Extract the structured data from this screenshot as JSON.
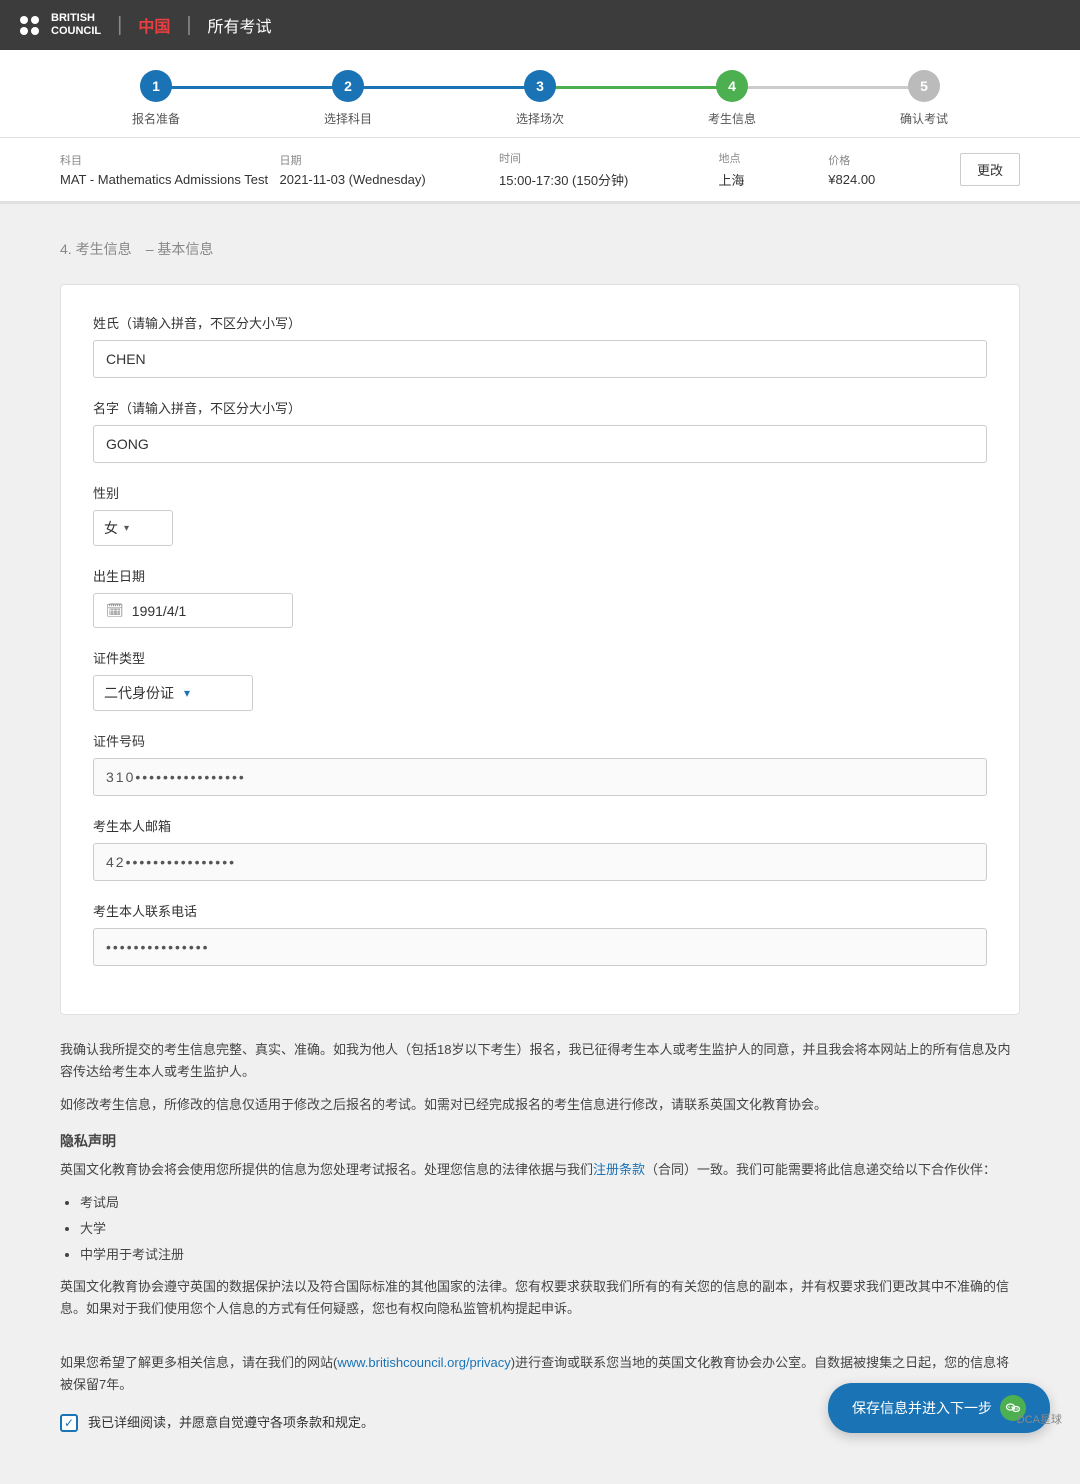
{
  "header": {
    "logo_line1": "BRITISH",
    "logo_line2": "COUNCIL",
    "divider": "|",
    "china": "中国",
    "separator": "|",
    "title": "所有考试"
  },
  "progress": {
    "steps": [
      {
        "id": 1,
        "label": "报名准备",
        "state": "completed"
      },
      {
        "id": 2,
        "label": "选择科目",
        "state": "completed"
      },
      {
        "id": 3,
        "label": "选择场次",
        "state": "completed"
      },
      {
        "id": 4,
        "label": "考生信息",
        "state": "active"
      },
      {
        "id": 5,
        "label": "确认考试",
        "state": "inactive"
      }
    ]
  },
  "exam_bar": {
    "subject_label": "科目",
    "subject_value": "MAT - Mathematics Admissions Test",
    "date_label": "日期",
    "date_value": "2021-11-03 (Wednesday)",
    "time_label": "时间",
    "time_value": "15:00-17:30 (150分钟)",
    "location_label": "地点",
    "location_value": "上海",
    "price_label": "价格",
    "price_value": "¥824.00",
    "change_btn": "更改"
  },
  "section": {
    "title": "4. 考生信息",
    "subtitle": "– 基本信息"
  },
  "form": {
    "lastname_label": "姓氏（请输入拼音，不区分大小写）",
    "lastname_value": "CHEN",
    "firstname_label": "名字（请输入拼音，不区分大小写）",
    "firstname_value": "GONG",
    "gender_label": "性别",
    "gender_value": "女",
    "gender_chevron": "▾",
    "dob_label": "出生日期",
    "dob_value": "1991/4/1",
    "calendar_icon": "📅",
    "cert_type_label": "证件类型",
    "cert_type_value": "二代身份证",
    "cert_chevron": "▾",
    "cert_num_label": "证件号码",
    "cert_num_value": "310••••••••••••••••",
    "email_label": "考生本人邮箱",
    "email_value": "42••••••••••••••••",
    "phone_label": "考生本人联系电话",
    "phone_value": "•••••••••••••••"
  },
  "notice": {
    "text1": "我确认我所提交的考生信息完整、真实、准确。如我为他人（包括18岁以下考生）报名，我已征得考生本人或考生监护人的同意，并且我会将本网站上的所有信息及内容传达给考生本人或考生监护人。",
    "text2": "如修改考生信息，所修改的信息仅适用于修改之后报名的考试。如需对已经完成报名的考生信息进行修改，请联系英国文化教育协会。"
  },
  "privacy": {
    "title": "隐私声明",
    "text1": "英国文化教育协会将会使用您所提供的信息为您处理考试报名。处理您信息的法律依据与我们",
    "link_text": "注册条款",
    "text1_cont": "（合同）一致。我们可能需要将此信息递交给以下合作伙伴：",
    "list_items": [
      "考试局",
      "大学",
      "中学用于考试注册"
    ],
    "text2": "英国文化教育协会遵守英国的数据保护法以及符合国际标准的其他国家的法律。您有权要求获取我们所有的有关您的信息的副本，并有权要求我们更改其中不准确的信息。如果对于我们使用您个人信息的方式有任何疑惑，您也有权向隐私监管机构提起申诉。",
    "text3": "如果您希望了解更多相关信息，请在我们的网站(",
    "link2_text": "www.britishcouncil.org/privacy",
    "text3_cont": ")进行查询或联系您当地的英国文化教育协会办公室。自数据被搜集之日起，您的信息将被保留7年。"
  },
  "checkbox": {
    "label": "我已详细阅读，并愿意自觉遵守各项条款和规定。",
    "checked": true
  },
  "save_button": {
    "label": "保存信息并进入下一步"
  },
  "watermark": {
    "text": "DCA星球"
  }
}
